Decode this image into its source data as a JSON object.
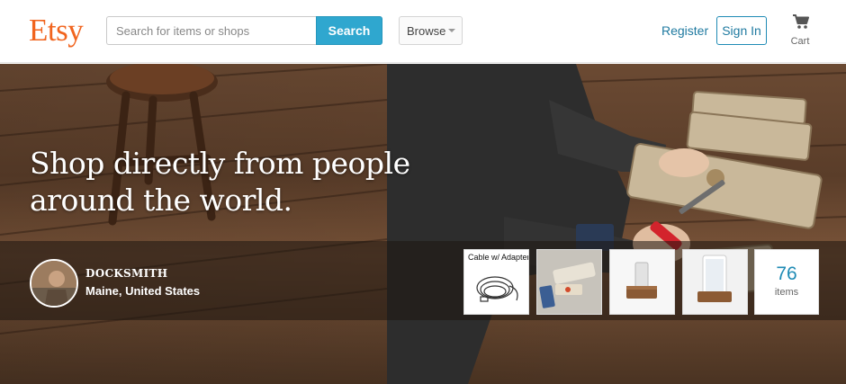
{
  "header": {
    "logo": "Etsy",
    "search": {
      "placeholder": "Search for items or shops",
      "button_label": "Search"
    },
    "browse_label": "Browse",
    "register_label": "Register",
    "signin_label": "Sign In",
    "cart_label": "Cart"
  },
  "hero": {
    "headline": "Shop directly from people around the world."
  },
  "shop": {
    "name": "DOCKSMITH",
    "location": "Maine, United States",
    "thumbnails": [
      {
        "caption": "Cable w/ Adapter",
        "icon": "cable-product"
      },
      {
        "caption": "",
        "icon": "phone-dock-product"
      },
      {
        "caption": "",
        "icon": "wooden-dock-product"
      },
      {
        "caption": "",
        "icon": "phone-stand-product"
      }
    ],
    "item_count": "76",
    "item_count_label": "items"
  },
  "colors": {
    "brand": "#f1641e",
    "accent": "#2fa7cf",
    "link": "#1f7aa0"
  }
}
